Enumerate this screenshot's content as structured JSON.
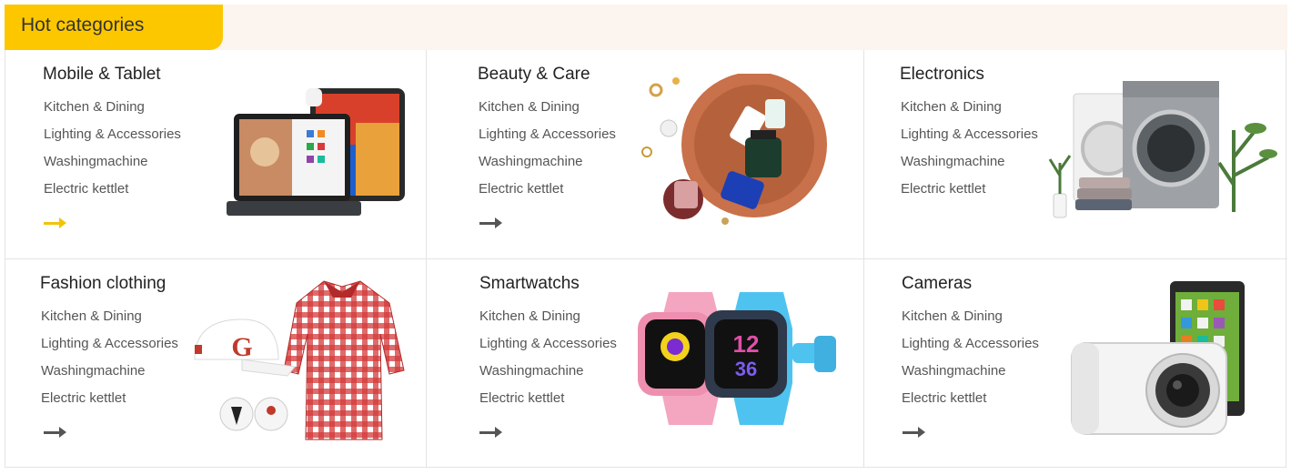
{
  "header": {
    "title": "Hot categories"
  },
  "colors": {
    "accent": "#fdc700",
    "header_bg": "#fcf4ee",
    "arrow_active": "#f2c30c",
    "arrow_default": "#555555"
  },
  "categories": [
    {
      "title": "Mobile & Tablet",
      "links": [
        "Kitchen & Dining",
        "Lighting & Accessories",
        "Washingmachine",
        "Electric kettlet"
      ],
      "arrow_state": "active",
      "image": "tablet-icon"
    },
    {
      "title": "Beauty & Care",
      "links": [
        "Kitchen & Dining",
        "Lighting & Accessories",
        "Washingmachine",
        "Electric kettlet"
      ],
      "arrow_state": "default",
      "image": "cosmetics-icon"
    },
    {
      "title": "Electronics",
      "links": [
        "Kitchen & Dining",
        "Lighting & Accessories",
        "Washingmachine",
        "Electric kettlet"
      ],
      "arrow_state": "default",
      "image": "washing-machine-icon"
    },
    {
      "title": "Fashion clothing",
      "links": [
        "Kitchen & Dining",
        "Lighting & Accessories",
        "Washingmachine",
        "Electric kettlet"
      ],
      "arrow_state": "default",
      "image": "shirt-icon"
    },
    {
      "title": "Smartwatchs",
      "links": [
        "Kitchen & Dining",
        "Lighting & Accessories",
        "Washingmachine",
        "Electric kettlet"
      ],
      "arrow_state": "default",
      "image": "smartwatch-icon"
    },
    {
      "title": "Cameras",
      "links": [
        "Kitchen & Dining",
        "Lighting & Accessories",
        "Washingmachine",
        "Electric kettlet"
      ],
      "arrow_state": "default",
      "image": "camera-icon"
    }
  ]
}
